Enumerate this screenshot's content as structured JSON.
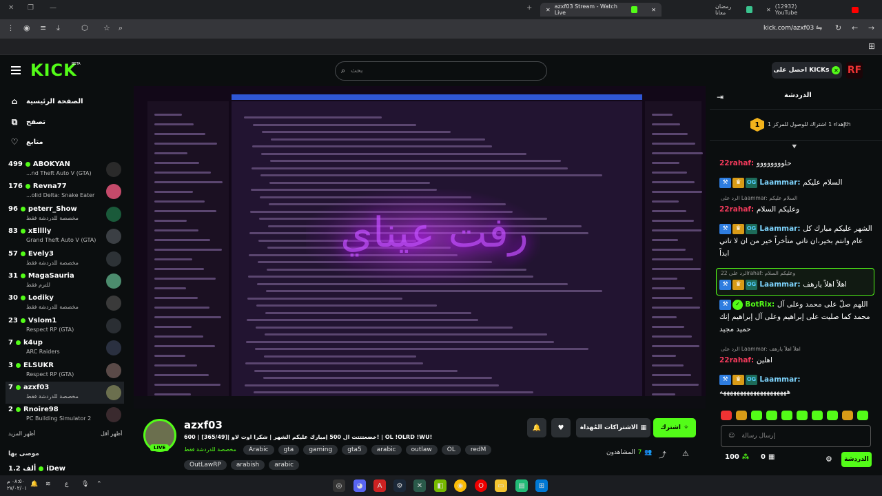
{
  "browser": {
    "tabs": [
      {
        "title": "(12932) YouTube"
      },
      {
        "title": "رمضان معانا"
      },
      {
        "title": "azxf03 Stream - Watch Live"
      }
    ],
    "url": "kick.com/azxf03"
  },
  "header": {
    "logo": "KICK",
    "beta": "BETA",
    "search_placeholder": "بحث",
    "get_kicks": "احصل على KICKs",
    "user_initials": "RF"
  },
  "sidebar": {
    "nav": [
      {
        "label": "الصفحة الرئيسية",
        "icon": "home-icon"
      },
      {
        "label": "تصفح",
        "icon": "browse-icon"
      },
      {
        "label": "متابع",
        "icon": "heart-icon"
      }
    ],
    "channels": [
      {
        "name": "ABOKYAN",
        "viewers": "499",
        "category": "...nd Theft Auto V (GTA)"
      },
      {
        "name": "Revna77",
        "viewers": "176",
        "category": "...olid Delta: Snake Eater"
      },
      {
        "name": "peterr_Show",
        "viewers": "96",
        "category": "مخصصة للدردشة فقط"
      },
      {
        "name": "xElllly",
        "viewers": "83",
        "category": "Grand Theft Auto V (GTA)"
      },
      {
        "name": "Evely3",
        "viewers": "57",
        "category": "مخصصة للدردشة فقط"
      },
      {
        "name": "MagaSauria",
        "viewers": "31",
        "category": "للترم فقط"
      },
      {
        "name": "Lodiky",
        "viewers": "30",
        "category": "مخصصة للدردشة فقط"
      },
      {
        "name": "Vslom1",
        "viewers": "23",
        "category": "Respect RP (GTA)"
      },
      {
        "name": "k4up",
        "viewers": "7",
        "category": "ARC Raiders"
      },
      {
        "name": "ELSUKR",
        "viewers": "3",
        "category": "Respect RP (GTA)"
      },
      {
        "name": "azxf03",
        "viewers": "7",
        "category": "مخصصة للدردشة فقط"
      },
      {
        "name": "Rnoire98",
        "viewers": "2",
        "category": "PC Building Simulator 2"
      }
    ],
    "show_more": "أظهر المزيد",
    "show_less": "أظهر أقل",
    "recommended_title": "موصى بها",
    "recommended_first": {
      "name": "iDew",
      "viewers": "1.2 ألف"
    }
  },
  "stream": {
    "streamer": "azxf03",
    "live": "LIVE",
    "title": "خضعتتتت ال 500 إمبارك عليكم الشهر | شكرا اوت لاو |[365/49] | 600! | OL !OLRD !WU!",
    "category": "مخصصة للدردشة فقط",
    "tags": [
      "Arabic",
      "gta",
      "gaming",
      "gta5",
      "arabic",
      "outlaw",
      "OL",
      "redM"
    ],
    "tags2": [
      "OutLawRP",
      "arabish",
      "arabic"
    ],
    "subscribe": "اشترك",
    "gift": "الاشتراكات المُهداة",
    "viewers_label": "المشاهدون",
    "viewers": "7",
    "overlay_text": "رفت عيناي"
  },
  "chat": {
    "title": "الدردشة",
    "goal": "إهداء 1 اشتراك للوصول للمركز 1th",
    "goal_rank": "1",
    "messages": [
      {
        "user": "22rahaf",
        "text": "حلوووووووو"
      },
      {
        "user": "Laammar",
        "text": "السلام عليكم"
      },
      {
        "reply": "الرد على Laammar: السلام عليكم",
        "user": "22rahaf",
        "text": "وعليكم السلام"
      },
      {
        "user": "Laammar",
        "text": "الشهر عليكم مبارك كل عام وانتم بخير،ان تاتي متأخراً خير من ان لا تاتي ابداً"
      },
      {
        "reply": "الرد على 22rahaf: وعليكم السلام",
        "user": "Laammar",
        "text": "اهلاً اهلاً يارهف"
      },
      {
        "user": "BotRix",
        "text": "اللهم صلّ على محمد وعلى آل محمد كما صليت على إبراهيم وعلى آل إبراهيم إنك حميد مجيد"
      },
      {
        "reply": "الرد على Laammar: اهلاً اهلاً يارهف",
        "user": "22rahaf",
        "text": "اهلين"
      },
      {
        "user": "Laammar",
        "text": "ههههههههههههههههههههه"
      }
    ],
    "input_placeholder": "إرسال رسالة",
    "points": "100",
    "gifts": "0",
    "send": "الدردشة"
  },
  "os": {
    "time": "٠٨:٥٠ م",
    "date": "٢٧/٠٢/٠١",
    "lang": "ع"
  }
}
